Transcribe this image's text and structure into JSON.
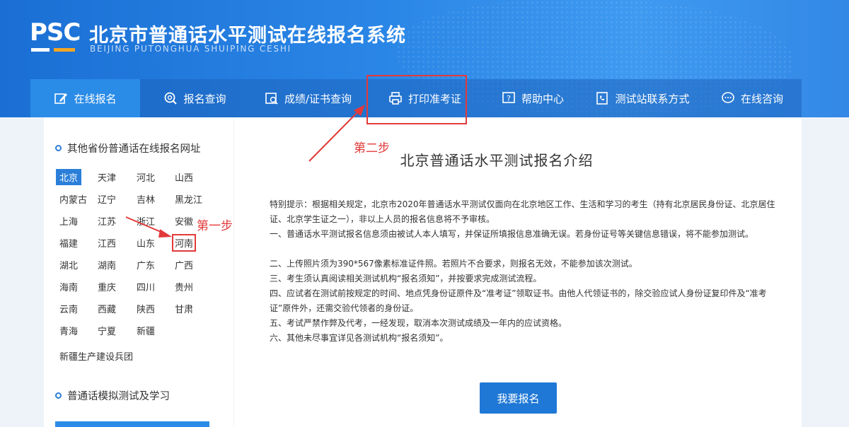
{
  "header": {
    "logo_text": "PSC",
    "title": "北京市普通话水平测试在线报名系统",
    "subtitle": "BEIJING PUTONGHUA SHUIPING CESHI"
  },
  "nav": {
    "items": [
      {
        "label": "在线报名",
        "icon": "edit-icon"
      },
      {
        "label": "报名查询",
        "icon": "search-icon"
      },
      {
        "label": "成绩/证书查询",
        "icon": "certificate-search-icon"
      },
      {
        "label": "打印准考证",
        "icon": "printer-icon"
      },
      {
        "label": "帮助中心",
        "icon": "help-icon"
      },
      {
        "label": "测试站联系方式",
        "icon": "phone-book-icon"
      },
      {
        "label": "在线咨询",
        "icon": "chat-icon"
      }
    ]
  },
  "sidebar": {
    "heading": "其他省份普通话在线报名网址",
    "provinces": [
      "北京",
      "天津",
      "河北",
      "山西",
      "内蒙古",
      "辽宁",
      "吉林",
      "黑龙江",
      "上海",
      "江苏",
      "浙江",
      "安徽",
      "福建",
      "江西",
      "山东",
      "河南",
      "湖北",
      "湖南",
      "广东",
      "广西",
      "海南",
      "重庆",
      "四川",
      "贵州",
      "云南",
      "西藏",
      "陕西",
      "甘肃",
      "青海",
      "宁夏",
      "新疆"
    ],
    "corps": "新疆生产建设兵团",
    "heading2": "普通话模拟测试及学习"
  },
  "main": {
    "title": "北京普通话水平测试报名介绍",
    "paragraphs": [
      "特别提示：根据相关规定，北京市2020年普通话水平测试仅面向在北京地区工作、生活和学习的考生（持有北京居民身份证、北京居住证、北京学生证之一），非以上人员的报名信息将不予审核。",
      "一、普通话水平测试报名信息须由被试人本人填写，并保证所填报信息准确无误。若身份证号等关键信息错误，将不能参加测试。",
      "二、上传照片须为390*567像素标准证件照。若照片不合要求，则报名无效，不能参加该次测试。",
      "三、考生须认真阅读相关测试机构“报名须知”，并按要求完成测试流程。",
      "四、应试者在测试前按规定的时间、地点凭身份证原件及“准考证”领取证书。由他人代领证书的，除交验应试人身份证复印件及“准考证”原件外，还需交验代领者的身份证。",
      "五、考试严禁作弊及代考，一经发现，取消本次测试成绩及一年内的应试资格。",
      "六、其他未尽事宜详见各测试机构“报名须知”。"
    ],
    "signup_label": "我要报名"
  },
  "annotations": {
    "step1": "第一步",
    "step2": "第二步"
  },
  "colors": {
    "brand": "#2b7fd9",
    "annotation": "#e23a3a"
  }
}
